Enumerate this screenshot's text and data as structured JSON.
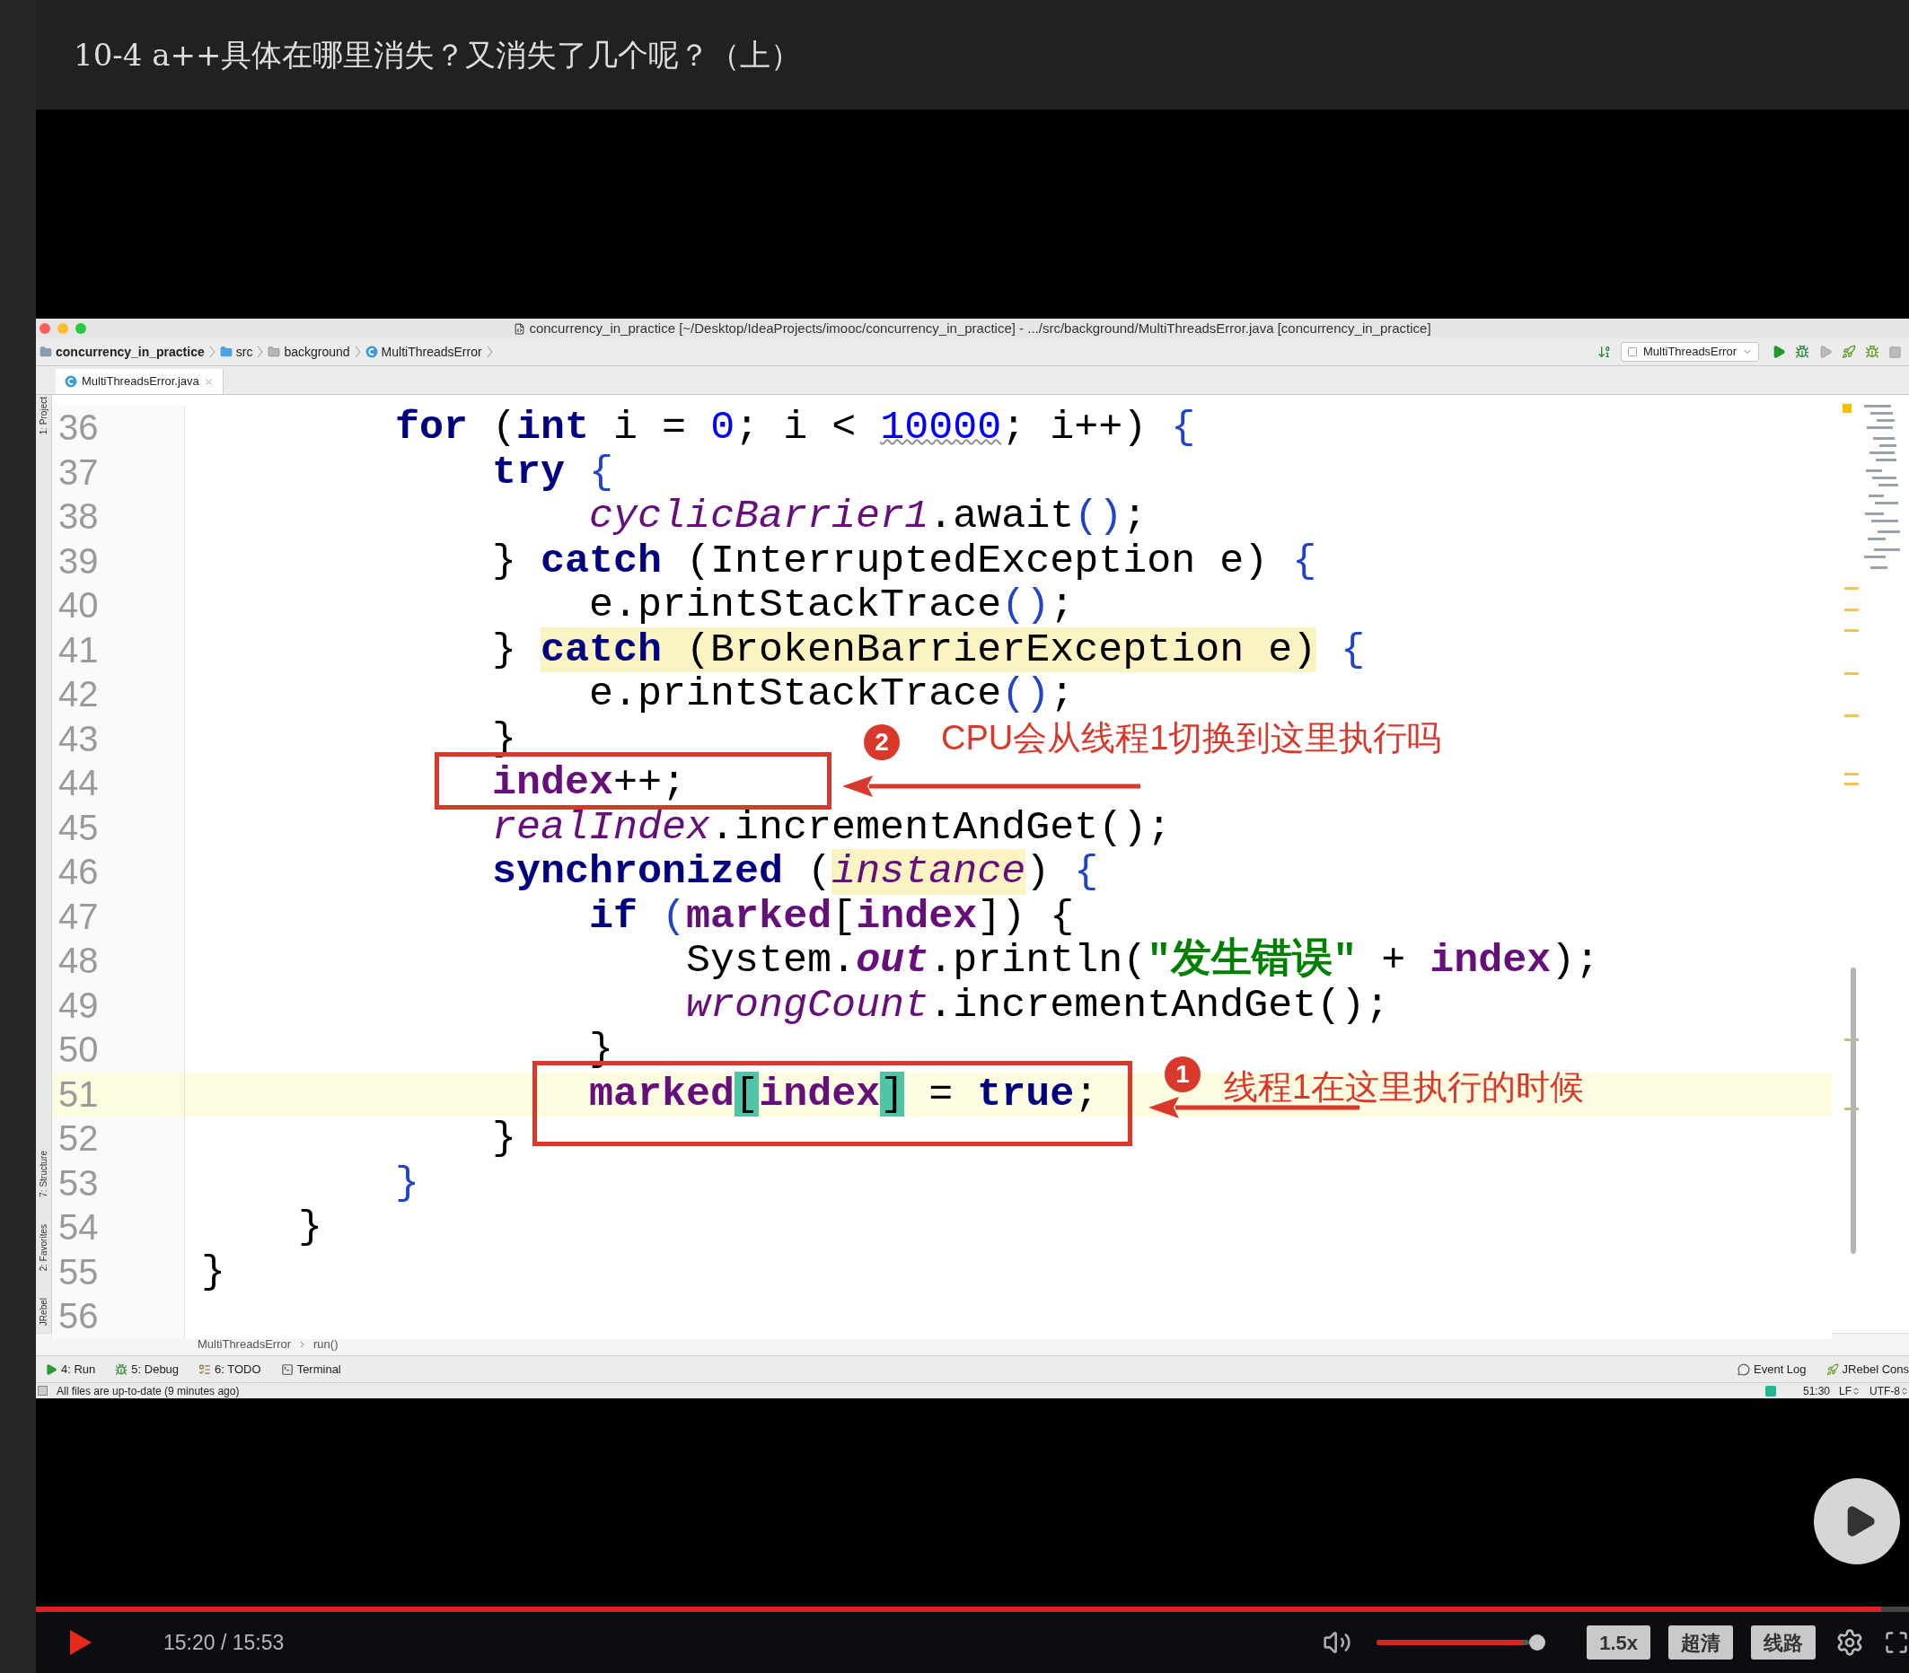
{
  "page_title": "10-4 a++具体在哪里消失？又消失了几个呢？（上）",
  "ide": {
    "window_title": "concurrency_in_practice [~/Desktop/IdeaProjects/imooc/concurrency_in_practice] - .../src/background/MultiThreadsError.java [concurrency_in_practice]",
    "breadcrumbs": [
      {
        "label": "concurrency_in_practice",
        "kind": "project"
      },
      {
        "label": "src",
        "kind": "folder"
      },
      {
        "label": "background",
        "kind": "package"
      },
      {
        "label": "MultiThreadsError",
        "kind": "class"
      }
    ],
    "run_config": "MultiThreadsError",
    "tabs": [
      {
        "label": "MultiThreadsError.java",
        "selected": true
      }
    ],
    "side_tools": {
      "top": [
        "1: Project"
      ],
      "bottom": [
        "7: Structure",
        "2: Favorites",
        "JRebel"
      ]
    },
    "code_lines": [
      {
        "number": "36",
        "current": false,
        "segments": [
          {
            "text": "        for",
            "kind": "keyword"
          },
          {
            "text": " (",
            "kind": "plain"
          },
          {
            "text": "int",
            "kind": "keyword"
          },
          {
            "text": " i = ",
            "kind": "plain"
          },
          {
            "text": "0",
            "kind": "number"
          },
          {
            "text": "; i < ",
            "kind": "plain"
          },
          {
            "text": "10000",
            "kind": "number-typo"
          },
          {
            "text": "; i++) ",
            "kind": "plain"
          },
          {
            "text": "{",
            "kind": "paren"
          }
        ]
      },
      {
        "number": "37",
        "current": false,
        "segments": [
          {
            "text": "            try",
            "kind": "keyword"
          },
          {
            "text": " {",
            "kind": "paren"
          }
        ]
      },
      {
        "number": "38",
        "current": false,
        "segments": [
          {
            "text": "                cyclicBarrier1",
            "kind": "field"
          },
          {
            "text": ".await",
            "kind": "plain"
          },
          {
            "text": "()",
            "kind": "paren"
          },
          {
            "text": ";",
            "kind": "plain"
          }
        ]
      },
      {
        "number": "39",
        "current": false,
        "segments": [
          {
            "text": "            } ",
            "kind": "plain"
          },
          {
            "text": "catch",
            "kind": "keyword"
          },
          {
            "text": " (InterruptedException e) ",
            "kind": "plain"
          },
          {
            "text": "{",
            "kind": "paren"
          }
        ]
      },
      {
        "number": "40",
        "current": false,
        "segments": [
          {
            "text": "                e.printStackTrace",
            "kind": "plain"
          },
          {
            "text": "()",
            "kind": "paren"
          },
          {
            "text": ";",
            "kind": "plain"
          }
        ]
      },
      {
        "number": "41",
        "current": false,
        "segments": [
          {
            "text": "            } ",
            "kind": "plain"
          },
          {
            "text": "catch",
            "kind": "keyword-hl"
          },
          {
            "text": " (BrokenBarrierException e)",
            "kind": "plain-hl"
          },
          {
            "text": " {",
            "kind": "paren"
          }
        ]
      },
      {
        "number": "42",
        "current": false,
        "segments": [
          {
            "text": "                e.printStackTrace",
            "kind": "plain"
          },
          {
            "text": "()",
            "kind": "paren"
          },
          {
            "text": ";",
            "kind": "plain"
          }
        ]
      },
      {
        "number": "43",
        "current": false,
        "segments": [
          {
            "text": "            }",
            "kind": "plain"
          }
        ]
      },
      {
        "number": "44",
        "current": false,
        "segments": [
          {
            "text": "            index",
            "kind": "var"
          },
          {
            "text": "++;",
            "kind": "plain"
          }
        ]
      },
      {
        "number": "45",
        "current": false,
        "segments": [
          {
            "text": "            realIndex",
            "kind": "field"
          },
          {
            "text": ".incrementAndGet();",
            "kind": "plain"
          }
        ]
      },
      {
        "number": "46",
        "current": false,
        "segments": [
          {
            "text": "            synchronized",
            "kind": "keyword"
          },
          {
            "text": " (",
            "kind": "plain"
          },
          {
            "text": "instance",
            "kind": "field-hl"
          },
          {
            "text": ") ",
            "kind": "plain"
          },
          {
            "text": "{",
            "kind": "paren"
          }
        ]
      },
      {
        "number": "47",
        "current": false,
        "segments": [
          {
            "text": "                if",
            "kind": "keyword"
          },
          {
            "text": " (",
            "kind": "paren"
          },
          {
            "text": "marked",
            "kind": "var"
          },
          {
            "text": "[",
            "kind": "plain"
          },
          {
            "text": "index",
            "kind": "var"
          },
          {
            "text": "]) {",
            "kind": "plain"
          }
        ]
      },
      {
        "number": "48",
        "current": false,
        "segments": [
          {
            "text": "                    System.",
            "kind": "plain"
          },
          {
            "text": "out",
            "kind": "static"
          },
          {
            "text": ".println(",
            "kind": "plain"
          },
          {
            "text": "\"发生错误\"",
            "kind": "string"
          },
          {
            "text": " + ",
            "kind": "plain"
          },
          {
            "text": "index",
            "kind": "var"
          },
          {
            "text": ");",
            "kind": "plain"
          }
        ]
      },
      {
        "number": "49",
        "current": false,
        "segments": [
          {
            "text": "                    wrongCount",
            "kind": "field"
          },
          {
            "text": ".incrementAndGet();",
            "kind": "plain"
          }
        ]
      },
      {
        "number": "50",
        "current": false,
        "segments": [
          {
            "text": "                }",
            "kind": "plain"
          }
        ]
      },
      {
        "number": "51",
        "current": true,
        "segments": [
          {
            "text": "                marked",
            "kind": "var"
          },
          {
            "text": "[",
            "kind": "bracket-match"
          },
          {
            "text": "index",
            "kind": "var"
          },
          {
            "text": "]",
            "kind": "bracket-match"
          },
          {
            "text": " = ",
            "kind": "plain"
          },
          {
            "text": "true",
            "kind": "keyword"
          },
          {
            "text": ";",
            "kind": "plain"
          }
        ]
      },
      {
        "number": "52",
        "current": false,
        "segments": [
          {
            "text": "            }",
            "kind": "plain"
          }
        ]
      },
      {
        "number": "53",
        "current": false,
        "segments": [
          {
            "text": "        }",
            "kind": "paren"
          }
        ]
      },
      {
        "number": "54",
        "current": false,
        "segments": [
          {
            "text": "    }",
            "kind": "plain"
          }
        ]
      },
      {
        "number": "55",
        "current": false,
        "segments": [
          {
            "text": "}",
            "kind": "plain"
          }
        ]
      },
      {
        "number": "56",
        "current": false
      }
    ],
    "annotations": [
      {
        "badge": "2",
        "text": "CPU会从线程1切换到这里执行吗"
      },
      {
        "badge": "1",
        "text": "线程1在这里执行的时候"
      }
    ],
    "editor_breadcrumb": [
      "MultiThreadsError",
      "run()"
    ],
    "tool_buttons": [
      {
        "label": "4: Run",
        "kind": "run"
      },
      {
        "label": "5: Debug",
        "kind": "debug"
      },
      {
        "label": "6: TODO",
        "kind": "todo"
      },
      {
        "label": "Terminal",
        "kind": "terminal"
      }
    ],
    "right_tools": [
      {
        "label": "Event Log",
        "kind": "log"
      },
      {
        "label": "JRebel Cons",
        "kind": "jrebel"
      }
    ],
    "status_message": "All files are up-to-date (9 minutes ago)",
    "status_items": [
      {
        "label": "51:30",
        "kind": "position"
      },
      {
        "label": "LF",
        "kind": "select"
      },
      {
        "label": "UTF-8",
        "kind": "select"
      }
    ]
  },
  "player": {
    "progress": {
      "level": 0.985
    },
    "time": "15:20 / 15:53",
    "volume": {
      "level": 0.96
    },
    "buttons": [
      "1.5x",
      "超清",
      "线路"
    ]
  }
}
